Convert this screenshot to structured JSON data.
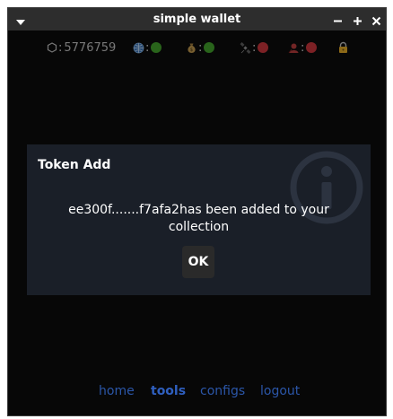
{
  "window": {
    "title": "simple wallet",
    "menu_icon": "chevron-down-icon",
    "controls": {
      "minimize_icon": "minus-icon",
      "maximize_icon": "plus-icon",
      "close_icon": "close-icon"
    }
  },
  "status": {
    "balance_icon": "hexagon-icon",
    "balance_label": ":",
    "balance_value": "5776759",
    "indicators": [
      {
        "icon": "globe-icon",
        "state": "ok",
        "color": "#3f9a2a"
      },
      {
        "icon": "money-bag-icon",
        "state": "ok",
        "color": "#3f9a2a"
      },
      {
        "icon": "satellite-icon",
        "state": "error",
        "color": "#c0343a"
      },
      {
        "icon": "user-icon",
        "state": "error",
        "color": "#c0343a"
      }
    ],
    "separator": ":",
    "lock_icon": "lock-icon"
  },
  "dialog": {
    "title": "Token Add",
    "message": "ee300f.......f7afa2has been added to your collection",
    "ok_label": "OK",
    "background_icon": "info-icon"
  },
  "nav": {
    "home": "home",
    "tools": "tools",
    "configs": "configs",
    "logout": "logout",
    "active": "tools"
  },
  "colors": {
    "background": "#0b0b0b",
    "titlebar": "#2d2d2d",
    "dialog": "#1a1f28",
    "nav_link": "#2b56a8",
    "ok_green": "#3f9a2a",
    "error_red": "#c0343a"
  }
}
